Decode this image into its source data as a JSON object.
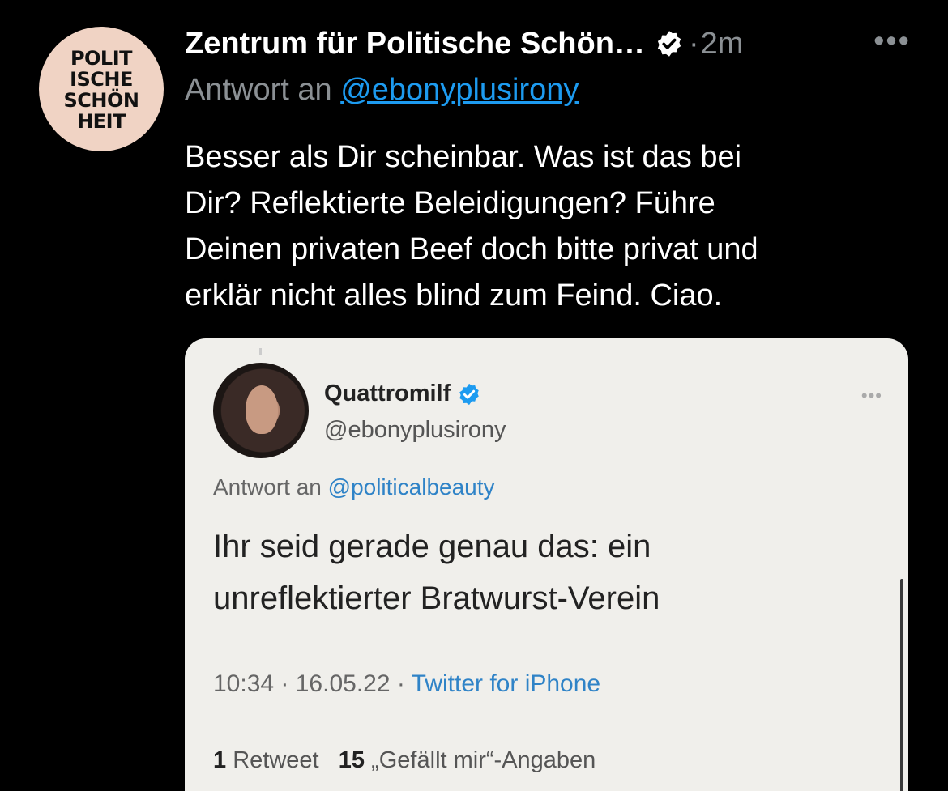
{
  "author": {
    "logo_lines": [
      "POLIT",
      "ISCHE",
      "SCHÖN",
      "HEIT"
    ],
    "display_name": "Zentrum für Politische Schön…",
    "separator": "·",
    "time": "2m",
    "more": "•••"
  },
  "reply": {
    "prefix": "Antwort an",
    "handle": "@ebonyplusirony"
  },
  "tweet_lines": [
    "Besser als Dir scheinbar. Was ist das bei",
    "Dir? Reflektierte Beleidigungen? Führe",
    "Deinen privaten Beef doch bitte privat und",
    "erklär nicht alles blind zum Feind. Ciao."
  ],
  "quoted": {
    "name": "Quattromilf",
    "handle": "@ebonyplusirony",
    "more": "•••",
    "reply_prefix": "Antwort an",
    "reply_handle": "@politicalbeauty",
    "text_lines": [
      "Ihr seid gerade genau das: ein",
      "unreflektierter Bratwurst-Verein"
    ],
    "time": "10:34",
    "date": "16.05.22",
    "source": "Twitter for iPhone",
    "retweet_count": "1",
    "retweet_label": "Retweet",
    "like_count": "15",
    "like_label": "„Gefällt mir“-Angaben"
  },
  "colors": {
    "background": "#000000",
    "link": "#1d9bf0",
    "verified": "#ffffff",
    "quoted_verified": "#1d9bf0",
    "card_background": "#f0efeb"
  }
}
